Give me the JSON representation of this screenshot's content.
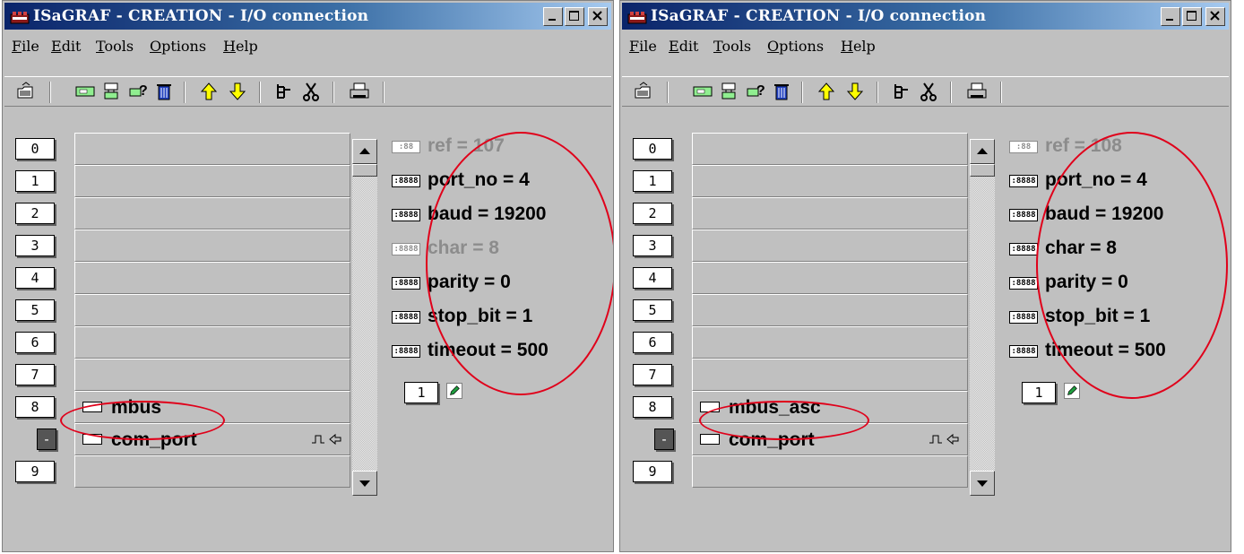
{
  "windows": [
    {
      "id": "left",
      "title": "ISaGRAF - CREATION - I/O connection",
      "menu": [
        "File",
        "Edit",
        "Tools",
        "Options",
        "Help"
      ],
      "slots": [
        {
          "num": "0",
          "text": ""
        },
        {
          "num": "1",
          "text": ""
        },
        {
          "num": "2",
          "text": ""
        },
        {
          "num": "3",
          "text": ""
        },
        {
          "num": "4",
          "text": ""
        },
        {
          "num": "5",
          "text": ""
        },
        {
          "num": "6",
          "text": ""
        },
        {
          "num": "7",
          "text": ""
        },
        {
          "num": "8",
          "text": "mbus"
        },
        {
          "num": "-",
          "text": "com_port"
        },
        {
          "num": "9",
          "text": ""
        }
      ],
      "params": [
        {
          "text": "ref = 107",
          "icon": ":88",
          "active": false
        },
        {
          "text": "port_no = 4",
          "icon": ":8888",
          "active": true
        },
        {
          "text": "baud = 19200",
          "icon": ":8888",
          "active": true
        },
        {
          "text": "char = 8",
          "icon": ":8888",
          "active": false
        },
        {
          "text": "parity = 0",
          "icon": ":8888",
          "active": true
        },
        {
          "text": "stop_bit = 1",
          "icon": ":8888",
          "active": true
        },
        {
          "text": "timeout = 500",
          "icon": ":8888",
          "active": true
        }
      ],
      "sub_num": "1"
    },
    {
      "id": "right",
      "title": "ISaGRAF - CREATION - I/O connection",
      "menu": [
        "File",
        "Edit",
        "Tools",
        "Options",
        "Help"
      ],
      "slots": [
        {
          "num": "0",
          "text": ""
        },
        {
          "num": "1",
          "text": ""
        },
        {
          "num": "2",
          "text": ""
        },
        {
          "num": "3",
          "text": ""
        },
        {
          "num": "4",
          "text": ""
        },
        {
          "num": "5",
          "text": ""
        },
        {
          "num": "6",
          "text": ""
        },
        {
          "num": "7",
          "text": ""
        },
        {
          "num": "8",
          "text": "mbus_asc"
        },
        {
          "num": "-",
          "text": "com_port"
        },
        {
          "num": "9",
          "text": ""
        }
      ],
      "params": [
        {
          "text": "ref = 108",
          "icon": ":88",
          "active": false
        },
        {
          "text": "port_no = 4",
          "icon": ":8888",
          "active": true
        },
        {
          "text": "baud = 19200",
          "icon": ":8888",
          "active": true
        },
        {
          "text": "char = 8",
          "icon": ":8888",
          "active": true
        },
        {
          "text": "parity = 0",
          "icon": ":8888",
          "active": true
        },
        {
          "text": "stop_bit = 1",
          "icon": ":8888",
          "active": true
        },
        {
          "text": "timeout = 500",
          "icon": ":8888",
          "active": true
        }
      ],
      "sub_num": "1"
    }
  ],
  "toolbar_icons": [
    "open-icon",
    "board-icon",
    "connect-icon",
    "help-icon",
    "delete-icon",
    "arrow-up-icon",
    "arrow-down-icon",
    "properties-icon",
    "cut-icon",
    "print-icon"
  ],
  "colors": {
    "titlebar_start": "#0a246a",
    "titlebar_end": "#a6caf0",
    "window_bg": "#c0c0c0",
    "annotation": "#e0001a"
  }
}
